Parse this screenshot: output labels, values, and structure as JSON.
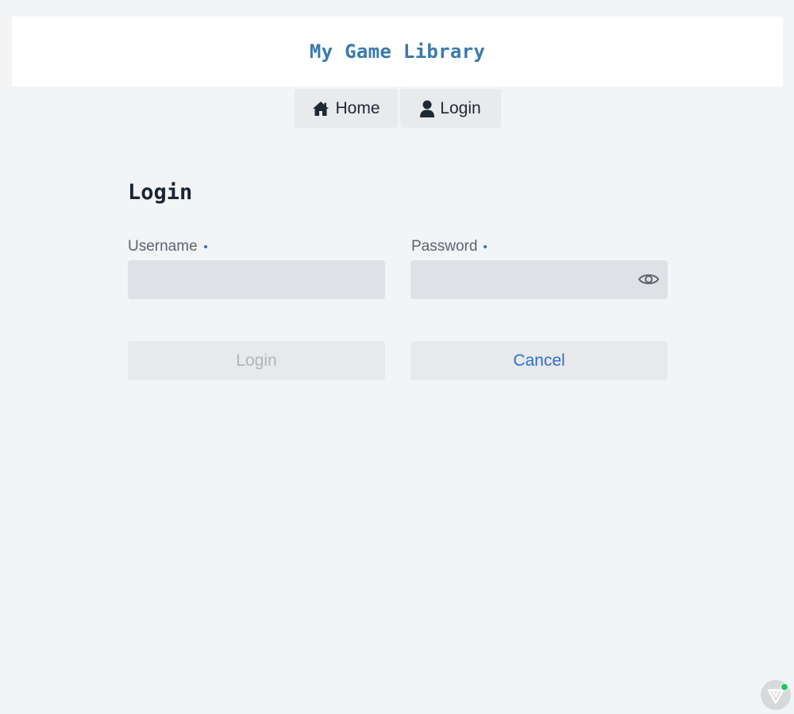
{
  "header": {
    "title": "My Game Library"
  },
  "nav": {
    "items": [
      {
        "label": "Home",
        "icon": "home-icon"
      },
      {
        "label": "Login",
        "icon": "user-icon"
      }
    ]
  },
  "form": {
    "title": "Login",
    "username": {
      "label": "Username",
      "value": "",
      "required": true
    },
    "password": {
      "label": "Password",
      "value": "",
      "required": true,
      "toggle_icon": "eye-icon"
    },
    "buttons": {
      "submit_label": "Login",
      "submit_disabled": true,
      "cancel_label": "Cancel"
    }
  },
  "colors": {
    "brand": "#3a7aae",
    "accent": "#2e6fd0",
    "background": "#f3f4f5",
    "field": "#dfe1e6",
    "status_online": "#22c55e"
  },
  "corner_widget": {
    "icon": "vuetify-logo-icon",
    "status": "online"
  }
}
